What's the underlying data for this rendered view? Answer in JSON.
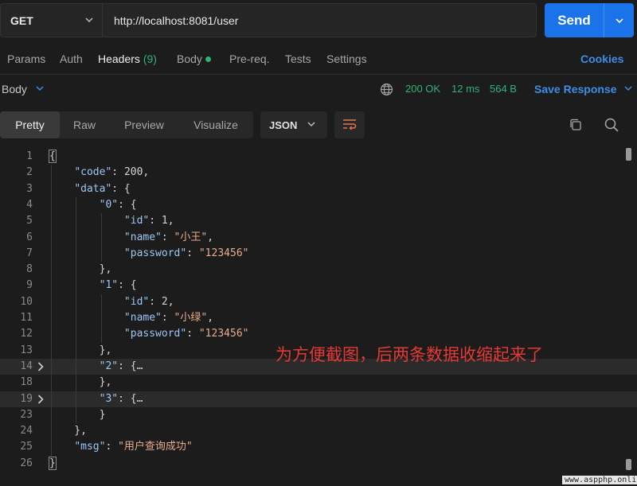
{
  "request": {
    "method": "GET",
    "url": "http://localhost:8081/user",
    "send_label": "Send"
  },
  "tabs": [
    {
      "label": "Params"
    },
    {
      "label": "Auth"
    },
    {
      "label": "Headers",
      "count": "(9)"
    },
    {
      "label": "Body"
    },
    {
      "label": "Pre-req."
    },
    {
      "label": "Tests"
    },
    {
      "label": "Settings"
    }
  ],
  "cookies_label": "Cookies",
  "response": {
    "body_label": "Body",
    "status": "200 OK",
    "time": "12 ms",
    "size": "564 B",
    "save_label": "Save Response"
  },
  "view_tabs": [
    "Pretty",
    "Raw",
    "Preview",
    "Visualize"
  ],
  "format": "JSON",
  "code_lines": [
    {
      "n": "1",
      "t": [
        [
          "p",
          "{"
        ]
      ]
    },
    {
      "n": "2",
      "t": [
        [
          "p",
          "    "
        ],
        [
          "k",
          "\"code\""
        ],
        [
          "p",
          ": "
        ],
        [
          "n",
          "200"
        ],
        [
          "p",
          ","
        ]
      ]
    },
    {
      "n": "3",
      "t": [
        [
          "p",
          "    "
        ],
        [
          "k",
          "\"data\""
        ],
        [
          "p",
          ": {"
        ]
      ]
    },
    {
      "n": "4",
      "t": [
        [
          "p",
          "        "
        ],
        [
          "k",
          "\"0\""
        ],
        [
          "p",
          ": {"
        ]
      ]
    },
    {
      "n": "5",
      "t": [
        [
          "p",
          "            "
        ],
        [
          "k",
          "\"id\""
        ],
        [
          "p",
          ": "
        ],
        [
          "n",
          "1"
        ],
        [
          "p",
          ","
        ]
      ]
    },
    {
      "n": "6",
      "t": [
        [
          "p",
          "            "
        ],
        [
          "k",
          "\"name\""
        ],
        [
          "p",
          ": "
        ],
        [
          "s",
          "\"小王\""
        ],
        [
          "p",
          ","
        ]
      ]
    },
    {
      "n": "7",
      "t": [
        [
          "p",
          "            "
        ],
        [
          "k",
          "\"password\""
        ],
        [
          "p",
          ": "
        ],
        [
          "s",
          "\"123456\""
        ]
      ]
    },
    {
      "n": "8",
      "t": [
        [
          "p",
          "        },"
        ]
      ]
    },
    {
      "n": "9",
      "t": [
        [
          "p",
          "        "
        ],
        [
          "k",
          "\"1\""
        ],
        [
          "p",
          ": {"
        ]
      ]
    },
    {
      "n": "10",
      "t": [
        [
          "p",
          "            "
        ],
        [
          "k",
          "\"id\""
        ],
        [
          "p",
          ": "
        ],
        [
          "n",
          "2"
        ],
        [
          "p",
          ","
        ]
      ]
    },
    {
      "n": "11",
      "t": [
        [
          "p",
          "            "
        ],
        [
          "k",
          "\"name\""
        ],
        [
          "p",
          ": "
        ],
        [
          "s",
          "\"小绿\""
        ],
        [
          "p",
          ","
        ]
      ]
    },
    {
      "n": "12",
      "t": [
        [
          "p",
          "            "
        ],
        [
          "k",
          "\"password\""
        ],
        [
          "p",
          ": "
        ],
        [
          "s",
          "\"123456\""
        ]
      ]
    },
    {
      "n": "13",
      "t": [
        [
          "p",
          "        },"
        ]
      ]
    },
    {
      "n": "14",
      "t": [
        [
          "p",
          "        "
        ],
        [
          "k",
          "\"2\""
        ],
        [
          "p",
          ": {"
        ],
        [
          "p",
          "…"
        ]
      ],
      "fold": true
    },
    {
      "n": "18",
      "t": [
        [
          "p",
          "        },"
        ]
      ]
    },
    {
      "n": "19",
      "t": [
        [
          "p",
          "        "
        ],
        [
          "k",
          "\"3\""
        ],
        [
          "p",
          ": {"
        ],
        [
          "p",
          "…"
        ]
      ],
      "fold": true
    },
    {
      "n": "23",
      "t": [
        [
          "p",
          "        }"
        ]
      ]
    },
    {
      "n": "24",
      "t": [
        [
          "p",
          "    },"
        ]
      ]
    },
    {
      "n": "25",
      "t": [
        [
          "p",
          "    "
        ],
        [
          "k",
          "\"msg\""
        ],
        [
          "p",
          ": "
        ],
        [
          "s",
          "\"用户查询成功\""
        ]
      ]
    },
    {
      "n": "26",
      "t": [
        [
          "p",
          "}"
        ]
      ]
    }
  ],
  "annotation": "为方便截图，后两条数据收缩起来了",
  "watermark": "www.aspphp.online",
  "colors": {
    "accent": "#1a73e8",
    "success": "#2fb375",
    "key": "#9cc6f5",
    "string": "#e8ad8b",
    "annotation": "#e53935"
  }
}
